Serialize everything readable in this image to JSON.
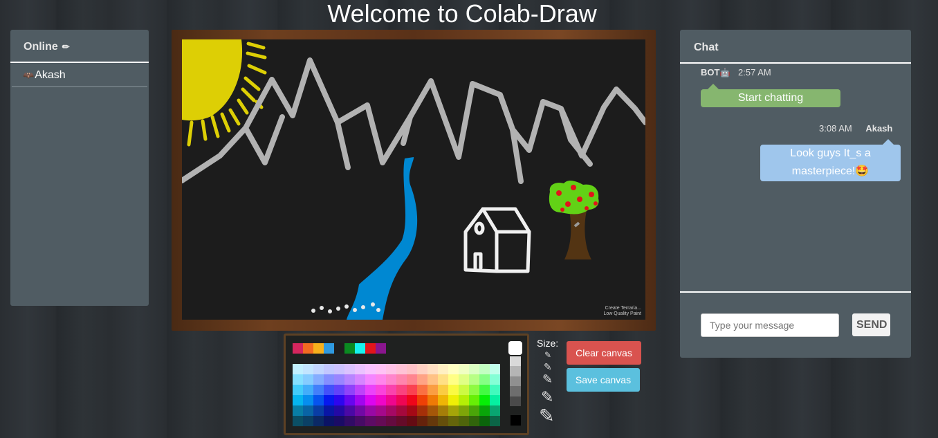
{
  "app": {
    "title": "Welcome to Colab-Draw"
  },
  "online": {
    "header": "Online",
    "header_icon": "pencil-icon",
    "users": [
      {
        "name": "Akash",
        "avatar_icon": "mask-avatar-icon"
      }
    ]
  },
  "canvas": {
    "watermark_line1": "Create Terraria...",
    "watermark_line2": "Low Quality Paint"
  },
  "palette": {
    "quick_colors": [
      "#d6265e",
      "#f26b22",
      "#f6b01c",
      "#2f9ae0",
      "#1e1e1e",
      "#0a8a21",
      "#17f2ef",
      "#e3151b",
      "#8a168e"
    ]
  },
  "tools": {
    "size_label": "Size:",
    "clear_label": "Clear canvas",
    "save_label": "Save canvas"
  },
  "chat": {
    "header": "Chat",
    "messages": [
      {
        "sender": "BOT",
        "time": "2:57 AM",
        "text": "Start chatting",
        "emoji": ""
      },
      {
        "sender": "Akash",
        "time": "3:08 AM",
        "text": "Look guys It_s a masterpiece!",
        "emoji": "🤩"
      }
    ],
    "input_placeholder": "Type your message",
    "send_label": "SEND"
  },
  "colors": {
    "clear_button": "#d9534f",
    "save_button": "#5bc0de",
    "bot_bubble": "#86b66f",
    "user_bubble": "#9fc6ec",
    "panel": "#505c63"
  }
}
